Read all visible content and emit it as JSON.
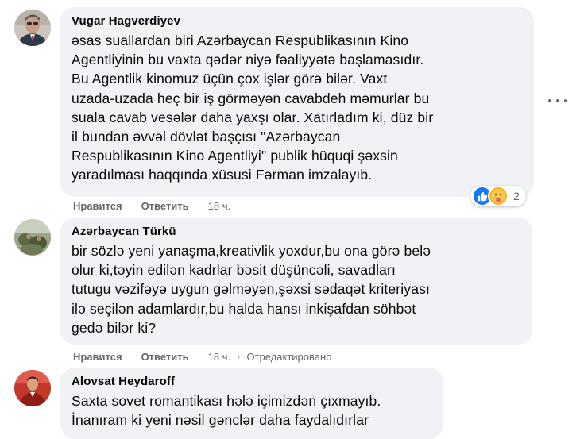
{
  "comments": [
    {
      "author": "Vugar Hagverdiyev",
      "text": "əsas suallardan biri Azərbaycan Respublikasının Kino\nAgentliyinin bu vaxta qədər niyə fəaliyyətə başlamasıdır.\nBu Agentlik kinomuz üçün çox işlər görə bilər. Vaxt\nuzada-uzada heç bir iş görməyən cavabdeh məmurlar bu\nsuala cavab vesələr daha yaxşı olar. Xatırladım ki, düz bir\nil bundan əvvəl dövlət başçısı \"Azərbaycan\nRespublikasının Kino Agentliyi\" publik hüquqi şəxsin\nyaradılması haqqında xüsusi Fərman imzalayıb.",
      "like_label": "Нравится",
      "reply_label": "Ответить",
      "time": "18 ч.",
      "reactions_count": "2"
    },
    {
      "author": "Azərbaycan Türkü",
      "text": "bir sözlə yeni yanaşma,kreativlik yoxdur,bu ona görə belə\nolur ki,təyin edilən kadrlar bəsit düşüncəli, savadları\ntutugu vəzifəyə uygun gəlməyən,şəxsi sədaqət kriteriyası\nilə seçilən adamlardır,bu halda hansı inkişafdan söhbət\ngedə bilər ki?",
      "like_label": "Нравится",
      "reply_label": "Ответить",
      "time": "18 ч.",
      "edited_label": "Отредактировано"
    },
    {
      "author": "Alovsat Heydaroff",
      "text": "Saxta sovet romantikası hələ içimizdən çıxmayıb.\nİnanıram ki yeni nəsil gənclər daha faydalıdırlar"
    }
  ],
  "icons": {
    "more": "more-horizontal-icon",
    "like_reaction": "like-reaction-icon",
    "care_reaction": "care-reaction-icon"
  },
  "colors": {
    "bubble": "#f0f2f5",
    "meta_text": "#65676b",
    "like_blue": "#1877f2",
    "care_yellow": "#f7b125"
  }
}
